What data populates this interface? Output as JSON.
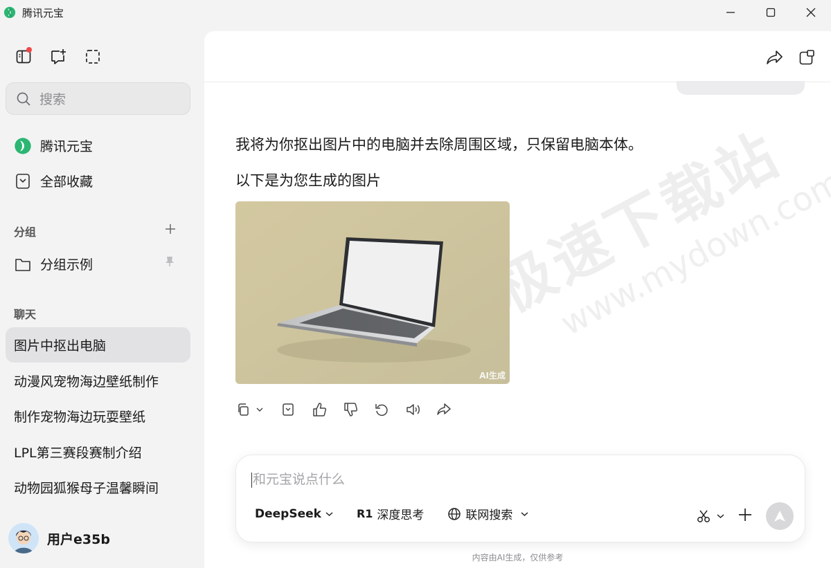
{
  "window": {
    "title": "腾讯元宝",
    "controls": [
      "minimize-icon",
      "maximize-icon",
      "close-icon"
    ]
  },
  "sidebar": {
    "top_icons": [
      "sidebar-toggle-icon",
      "new-chat-icon",
      "screenshot-icon"
    ],
    "search_placeholder": "搜索",
    "nav": [
      {
        "label": "腾讯元宝",
        "icon": "yuanbao-logo"
      },
      {
        "label": "全部收藏",
        "icon": "bookmark-icon"
      }
    ],
    "groups_label": "分组",
    "groups": [
      {
        "label": "分组示例",
        "icon": "folder-icon",
        "pinned": true
      }
    ],
    "chats_label": "聊天",
    "chats": [
      {
        "label": "图片中抠出电脑",
        "active": true
      },
      {
        "label": "动漫风宠物海边壁纸制作"
      },
      {
        "label": "制作宠物海边玩耍壁纸"
      },
      {
        "label": "LPL第三赛段赛制介绍"
      },
      {
        "label": "动物园狐猴母子温馨瞬间"
      }
    ],
    "user": {
      "name": "用户e35b"
    }
  },
  "chat": {
    "header_icons": [
      "share-icon",
      "new-window-icon"
    ],
    "messages": [
      "我将为你抠出图片中的电脑并去除周围区域，只保留电脑本体。",
      "以下是为您生成的图片"
    ],
    "image_mark": "AI生成",
    "action_icons": [
      "copy-icon",
      "chevron-down-icon",
      "bookmark-icon",
      "thumbs-up-icon",
      "thumbs-down-icon",
      "regenerate-icon",
      "speaker-icon",
      "share-icon"
    ],
    "watermark": {
      "cn": "极速下载站",
      "en": "www.mydown.com"
    }
  },
  "composer": {
    "placeholder": "和元宝说点什么",
    "model": "DeepSeek",
    "deep_think": "深度思考",
    "deep_think_badge": "R1",
    "web_search": "联网搜索",
    "right_icons": [
      "scissors-icon",
      "chevron-down-icon",
      "plus-icon",
      "send-icon"
    ]
  },
  "footer_note": "内容由AI生成，仅供参考",
  "colors": {
    "accent_green": "#2bb673",
    "sidebar_bg": "#f3f3f4",
    "active_item_bg": "#e2e2e4",
    "notification_dot": "#f04848"
  }
}
